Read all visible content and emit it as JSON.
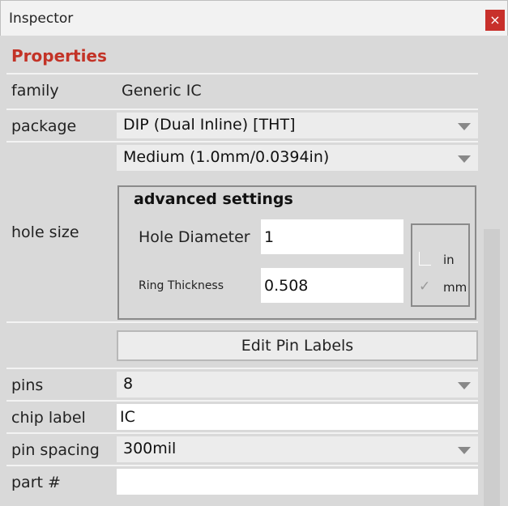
{
  "window": {
    "title": "Inspector",
    "close_label": "×"
  },
  "heading": "Properties",
  "rows": {
    "family": {
      "label": "family",
      "value": "Generic IC"
    },
    "package": {
      "label": "package",
      "value": "DIP (Dual Inline) [THT]"
    },
    "hole_size": {
      "label": "hole size",
      "value": "Medium (1.0mm/0.0394in)",
      "advanced": {
        "title": "advanced settings",
        "hole_diameter_label": "Hole Diameter",
        "hole_diameter_value": "1",
        "ring_thickness_label": "Ring Thickness",
        "ring_thickness_value": "0.508",
        "units": [
          {
            "label": "in",
            "checked": false
          },
          {
            "label": "mm",
            "checked": true
          }
        ]
      }
    },
    "edit_button": "Edit Pin Labels",
    "pins": {
      "label": "pins",
      "value": "8"
    },
    "chip_label": {
      "label": "chip label",
      "value": "IC"
    },
    "pin_spacing": {
      "label": "pin spacing",
      "value": "300mil"
    },
    "part_number": {
      "label": "part #",
      "value": ""
    }
  },
  "colors": {
    "heading": "#c33327",
    "close_button": "#c8302b"
  },
  "icons": {
    "dropdown": "triangle-down",
    "check": "checkmark"
  }
}
